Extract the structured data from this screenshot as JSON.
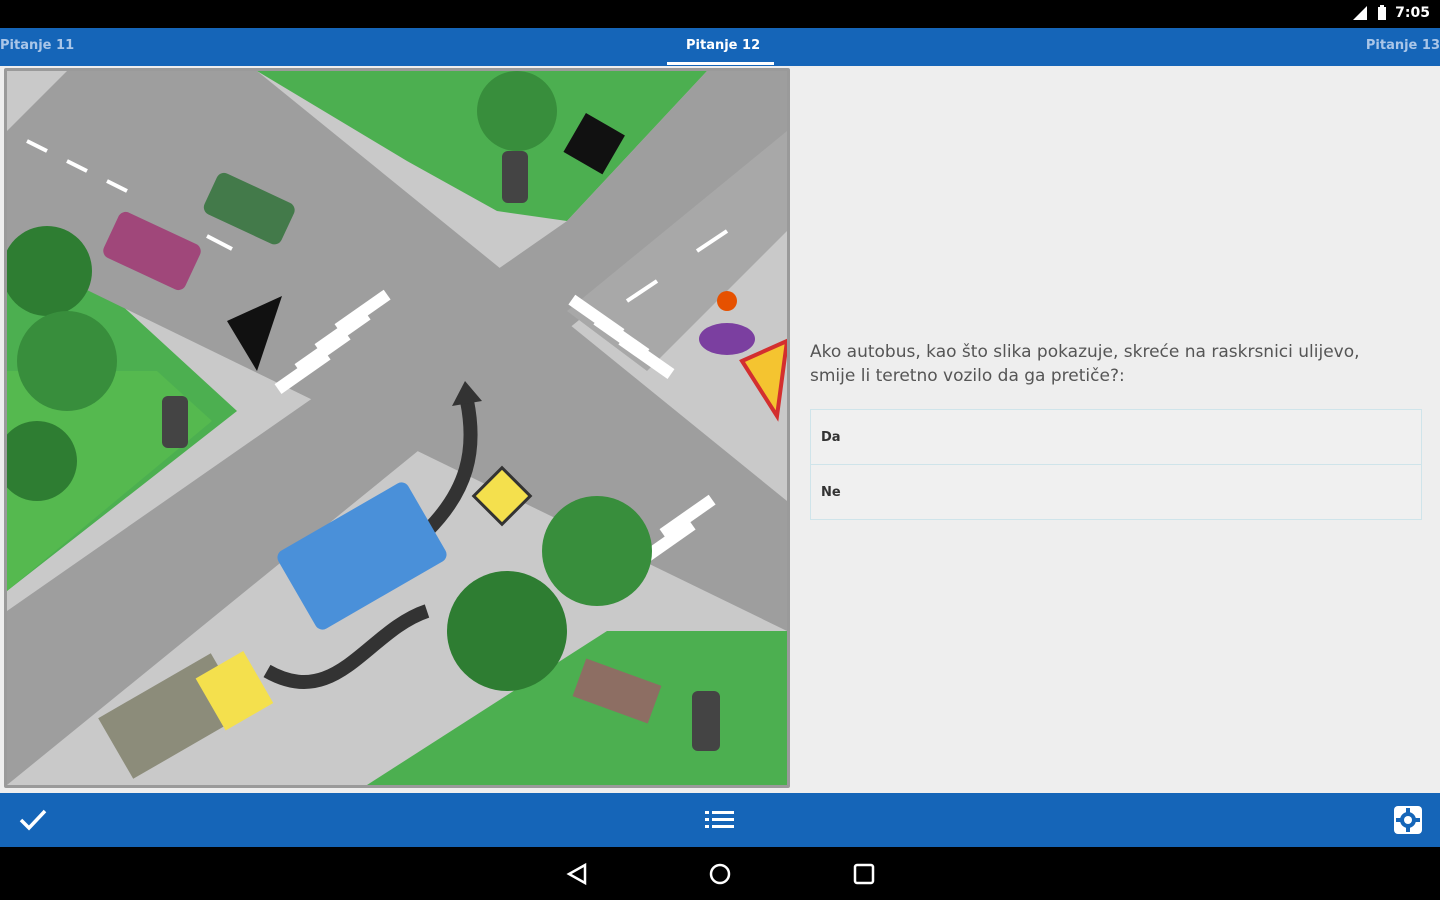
{
  "status": {
    "time": "7:05"
  },
  "tabs": {
    "prev": "Pitanje 11",
    "current": "Pitanje 12",
    "next": "Pitanje 13"
  },
  "question": {
    "text": "Ako autobus, kao što slika pokazuje, skreće na raskrsnici ulijevo, smije li teretno vozilo da ga pretiče?:"
  },
  "answers": [
    "Da",
    "Ne"
  ],
  "icons": {
    "confirm": "check-icon",
    "list": "list-icon",
    "settings": "gear-icon",
    "back": "back-triangle-icon",
    "home": "home-circle-icon",
    "recents": "recents-square-icon"
  },
  "colors": {
    "accent": "#1565b8",
    "status_bar": "#000000",
    "answer_border": "#cfe4ea"
  }
}
